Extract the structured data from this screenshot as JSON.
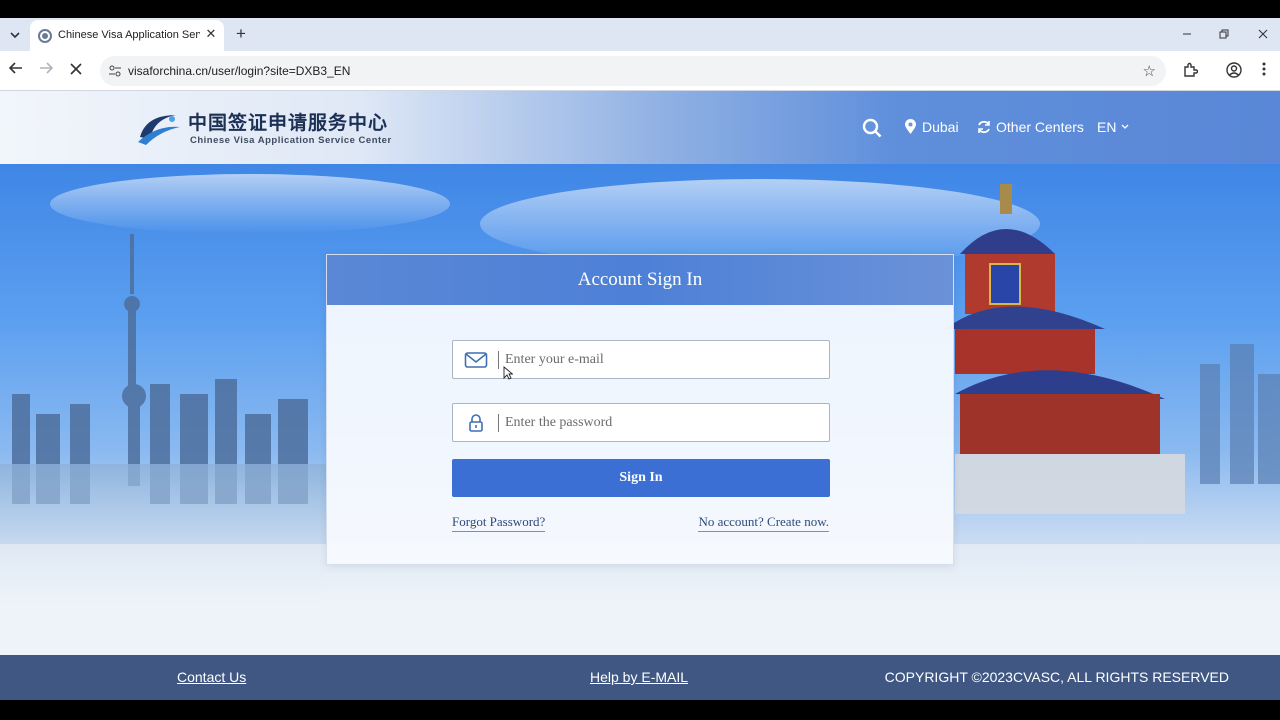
{
  "browser": {
    "tab_title": "Chinese Visa Application Service Center",
    "tab_close": "✕",
    "new_tab": "+",
    "url": "visaforchina.cn/user/login?site=DXB3_EN",
    "icons": [
      "tab-list-icon",
      "favicon-icon",
      "back-icon",
      "forward-icon",
      "stop-icon",
      "site-info-icon",
      "bookmark-star-icon",
      "extensions-icon",
      "profile-icon",
      "menu-icon",
      "minimize-icon",
      "restore-icon",
      "close-icon"
    ]
  },
  "header": {
    "logo_cn": "中国签证申请服务中心",
    "logo_en": "Chinese Visa Application Service Center",
    "location": "Dubai",
    "other_centers": "Other Centers",
    "language": "EN"
  },
  "login": {
    "title": "Account Sign In",
    "email_placeholder": "Enter your e-mail",
    "email_value": "",
    "password_placeholder": "Enter the password",
    "password_value": "",
    "signin_label": "Sign In",
    "forgot_label": "Forgot Password?",
    "create_label": "No account? Create now."
  },
  "footer": {
    "contact": "Contact Us",
    "help": "Help by E-MAIL",
    "copyright": "COPYRIGHT ©2023CVASC, ALL RIGHTS RESERVED"
  },
  "colors": {
    "brand_blue": "#3b6fd3",
    "footer_bg": "#3f5782",
    "header_gradient_end": "#5a87d7"
  }
}
